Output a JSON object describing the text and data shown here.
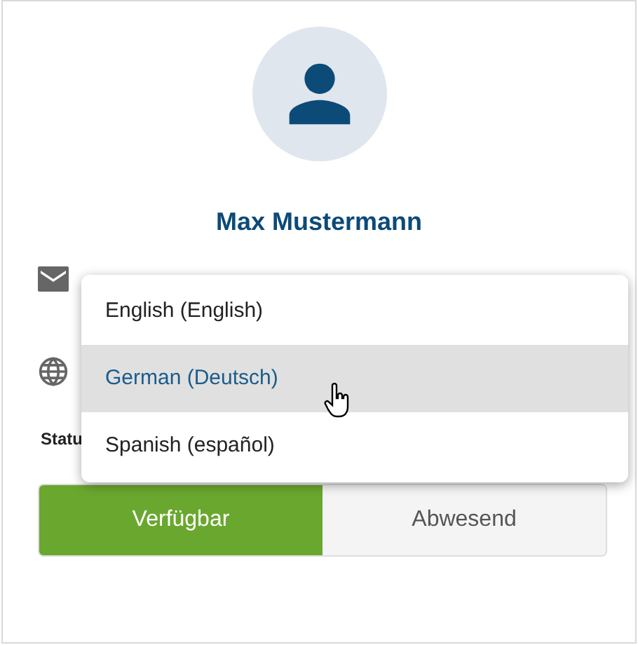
{
  "profile": {
    "name": "Max Mustermann"
  },
  "status_label": "Statu",
  "status_toggle": [
    {
      "label": "Verfügbar",
      "selected": true
    },
    {
      "label": "Abwesend",
      "selected": false
    }
  ],
  "language_menu": [
    {
      "label": "English (English)",
      "selected": false
    },
    {
      "label": "German (Deutsch)",
      "selected": true
    },
    {
      "label": "Spanish (español)",
      "selected": false
    }
  ]
}
